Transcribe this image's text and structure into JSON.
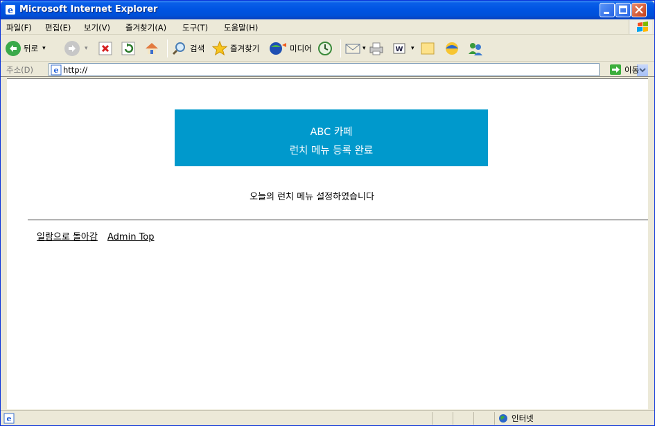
{
  "window": {
    "title": "Microsoft Internet Explorer"
  },
  "menu": {
    "items": [
      "파일(F)",
      "편집(E)",
      "보기(V)",
      "즐겨찾기(A)",
      "도구(T)",
      "도움말(H)"
    ]
  },
  "toolbar": {
    "back_label": "뒤로",
    "search_label": "검색",
    "favorites_label": "즐겨찾기",
    "media_label": "미디어"
  },
  "address": {
    "label": "주소(D)",
    "value": "http://",
    "go_label": "이동"
  },
  "page": {
    "banner_title": "ABC 카페",
    "banner_subtitle": "런치 메뉴 등록 완료",
    "message": "오늘의 런치 메뉴 설정하였습니다",
    "links": [
      "일람으로 돌아감",
      "Admin Top"
    ]
  },
  "status": {
    "zone": "인터넷"
  },
  "colors": {
    "banner": "#0099cc",
    "titlebar": "#0054e3"
  }
}
